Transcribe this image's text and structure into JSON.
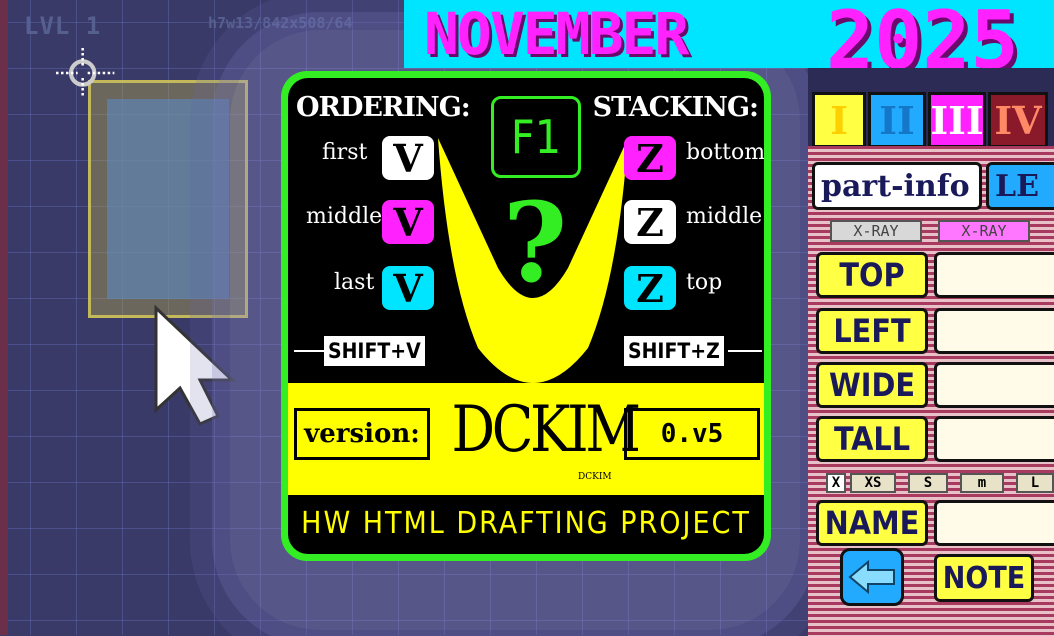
{
  "canvas": {
    "level_label": "LVL 1",
    "dimensions_readout": "h7w13/842x508/64"
  },
  "banner": {
    "month": "NOVEMBER",
    "year": "2025"
  },
  "help_dialog": {
    "f1_label": "F1",
    "question_mark": "?",
    "ordering": {
      "title": "ORDERING:",
      "rows": [
        {
          "label": "first",
          "key": "V",
          "color": "#ffffff"
        },
        {
          "label": "middle",
          "key": "V",
          "color": "#ff22ff"
        },
        {
          "label": "last",
          "key": "V",
          "color": "#00e5ff"
        }
      ],
      "shortcut": "SHIFT+V"
    },
    "stacking": {
      "title": "STACKING:",
      "rows": [
        {
          "label": "bottom",
          "key": "Z",
          "color": "#ff22ff"
        },
        {
          "label": "middle",
          "key": "Z",
          "color": "#ffffff"
        },
        {
          "label": "top",
          "key": "Z",
          "color": "#00e5ff"
        }
      ],
      "shortcut": "SHIFT+Z"
    },
    "version_label": "version:",
    "brand": "DCKIM",
    "brand_small": "DCKIM",
    "version_value": "0.v5",
    "footer": "HW HTML DRAFTING PROJECT"
  },
  "panel": {
    "tabs": [
      {
        "label": "I",
        "bg": "#ffff44",
        "fg": "#ffd000"
      },
      {
        "label": "II",
        "bg": "#22aaff",
        "fg": "#1477c8"
      },
      {
        "label": "III",
        "bg": "#ff22ff",
        "fg": "#ffffff"
      },
      {
        "label": "IV",
        "bg": "#8a1a2a",
        "fg": "#ff8866"
      }
    ],
    "part_info_tab": "part-info",
    "second_tab": "LE",
    "xray_1": "X-RAY",
    "xray_2": "X-RAY",
    "fields": {
      "top": "TOP",
      "left": "LEFT",
      "wide": "WIDE",
      "tall": "TALL",
      "name": "NAME"
    },
    "sizes": {
      "checkbox": "X",
      "xs": "XS",
      "s": "S",
      "m": "m",
      "l": "L"
    },
    "note_button": "NOTE"
  }
}
